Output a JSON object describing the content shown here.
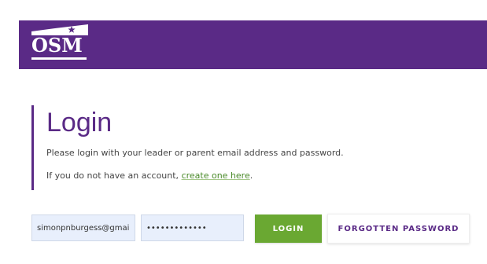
{
  "header": {
    "logo_text": "OSM",
    "brand_color": "#5a2a86"
  },
  "main": {
    "title": "Login",
    "instructions": "Please login with your leader or parent email address and password.",
    "no_account_prefix": "If you do not have an account, ",
    "create_link": "create one here",
    "no_account_suffix": "."
  },
  "form": {
    "email_value": "simonpnburgess@gmail",
    "password_value": "•••••••••••••",
    "login_label": "LOGIN",
    "forgot_label": "FORGOTTEN PASSWORD"
  },
  "colors": {
    "login_button": "#6aa832",
    "link": "#4a8a2a",
    "input_bg": "#e8effc"
  },
  "icons": {
    "logo_flag": "star-flag-icon"
  }
}
